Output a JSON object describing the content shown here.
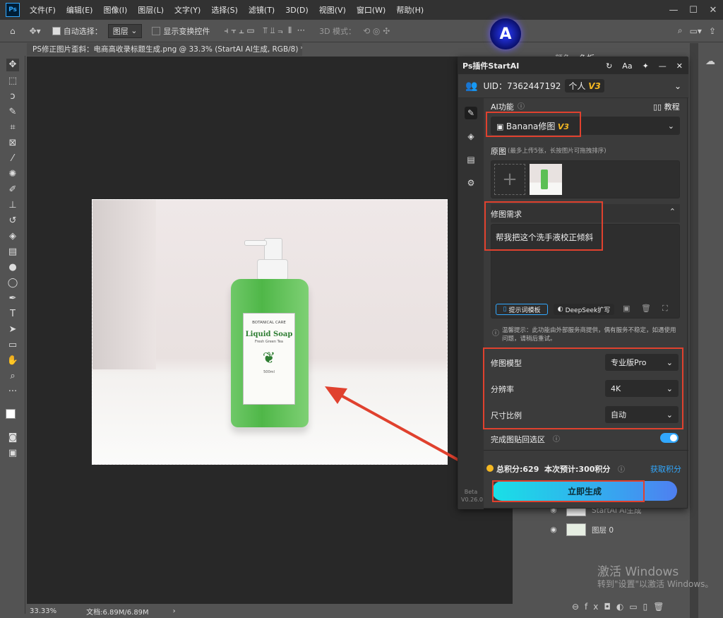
{
  "app": {
    "logo": "Ps"
  },
  "menu": [
    "文件(F)",
    "编辑(E)",
    "图像(I)",
    "图层(L)",
    "文字(Y)",
    "选择(S)",
    "滤镜(T)",
    "3D(D)",
    "视图(V)",
    "窗口(W)",
    "帮助(H)"
  ],
  "window_controls": {
    "minimize": "—",
    "maximize": "☐",
    "close": "✕"
  },
  "options_bar": {
    "auto_select_label": "自动选择：",
    "auto_select_target": "图层",
    "show_transform_label": "显示变换控件",
    "mode_3d_label": "3D 模式："
  },
  "document_tab": {
    "title": "PS修正图片歪斜：电商高收录标题生成.png @ 33.3% (StartAI AI生成, RGB/8) *",
    "close": "×"
  },
  "status": {
    "zoom": "33.33%",
    "doc_info": "文档:6.89M/6.89M",
    "arrow": "›"
  },
  "right_panel_tabs": [
    "颜色",
    "色板"
  ],
  "photo": {
    "brand": "BOTANICAL CARE",
    "product": "Liquid Soap",
    "subtitle": "Fresh Green Tea",
    "volume": "500ml"
  },
  "plugin": {
    "title": "Ps插件StartAI",
    "uid_label": "UID：7362447192",
    "account_type": "个人",
    "version_badge": "V3",
    "ai_function_label": "AI功能",
    "tutorial_label": "教程",
    "function_select": "Banana修图",
    "function_badge": "V3",
    "source_label": "原图",
    "source_hint": "(最多上传5张，长按图片可拖拽排序)",
    "requirement_label": "修图需求",
    "requirement_text": "帮我把这个洗手液校正倾斜",
    "prompt_template_btn": "提示词模板",
    "deepseek_btn": "DeepSeek扩写",
    "notice": "温馨提示：此功能由外部服务商提供，偶有服务不稳定，如遇使用问题，请稍后重试。",
    "model_label": "修图模型",
    "model_value": "专业版Pro",
    "resolution_label": "分辨率",
    "resolution_value": "4K",
    "ratio_label": "尺寸比例",
    "ratio_value": "自动",
    "paste_back_label": "完成图贴回选区",
    "paste_back_on": true,
    "points_text": "总积分:629  本次预计:300积分",
    "get_points": "获取积分",
    "beta_label": "Beta",
    "version_label": "V0.26.0",
    "generate_btn": "立即生成"
  },
  "layers": [
    {
      "name": "StartAI AI生成"
    },
    {
      "name": "图层 0"
    }
  ],
  "activation": {
    "title": "激活 Windows",
    "subtitle": "转到\"设置\"以激活 Windows。"
  },
  "colors": {
    "annotation_red": "#e0412e",
    "accent_blue": "#31a8ff",
    "bottle_green": "#5cbf54"
  }
}
